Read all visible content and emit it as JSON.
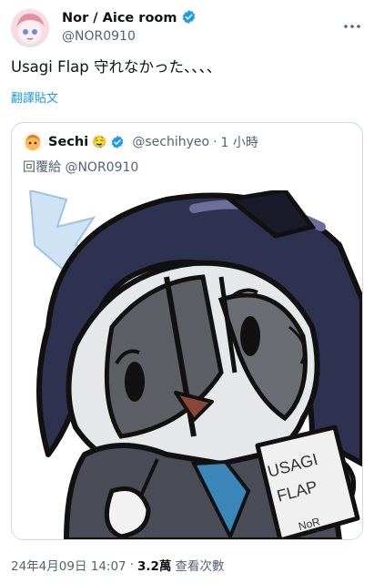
{
  "tweet": {
    "author": {
      "display_name": "Nor / Aice room",
      "handle": "@NOR0910",
      "verified": true
    },
    "text": "Usagi Flap 守れなかった、、、、",
    "translate_label": "翻譯貼文",
    "quoted": {
      "display_name": "Sechi",
      "display_name_emoji": "🤤",
      "handle": "@sechihyeo",
      "separator": "·",
      "time": "1 小時",
      "reply_prefix": "回覆給",
      "reply_handle": "@NOR0910",
      "image_text": {
        "line1": "USAGI",
        "line2": "FLAP",
        "line3": "NoR"
      }
    },
    "meta": {
      "date": "24年4月09日 14:07",
      "separator": "·",
      "views": "3.2萬",
      "views_label": "查看次數"
    }
  },
  "colors": {
    "text": "#0f1419",
    "secondary": "#536471",
    "link": "#1d9bf0",
    "verified": "#1d9bf0",
    "border": "#cfd9de"
  },
  "icons": {
    "verified": "verified-badge-icon",
    "more": "more-horizontal-icon"
  }
}
